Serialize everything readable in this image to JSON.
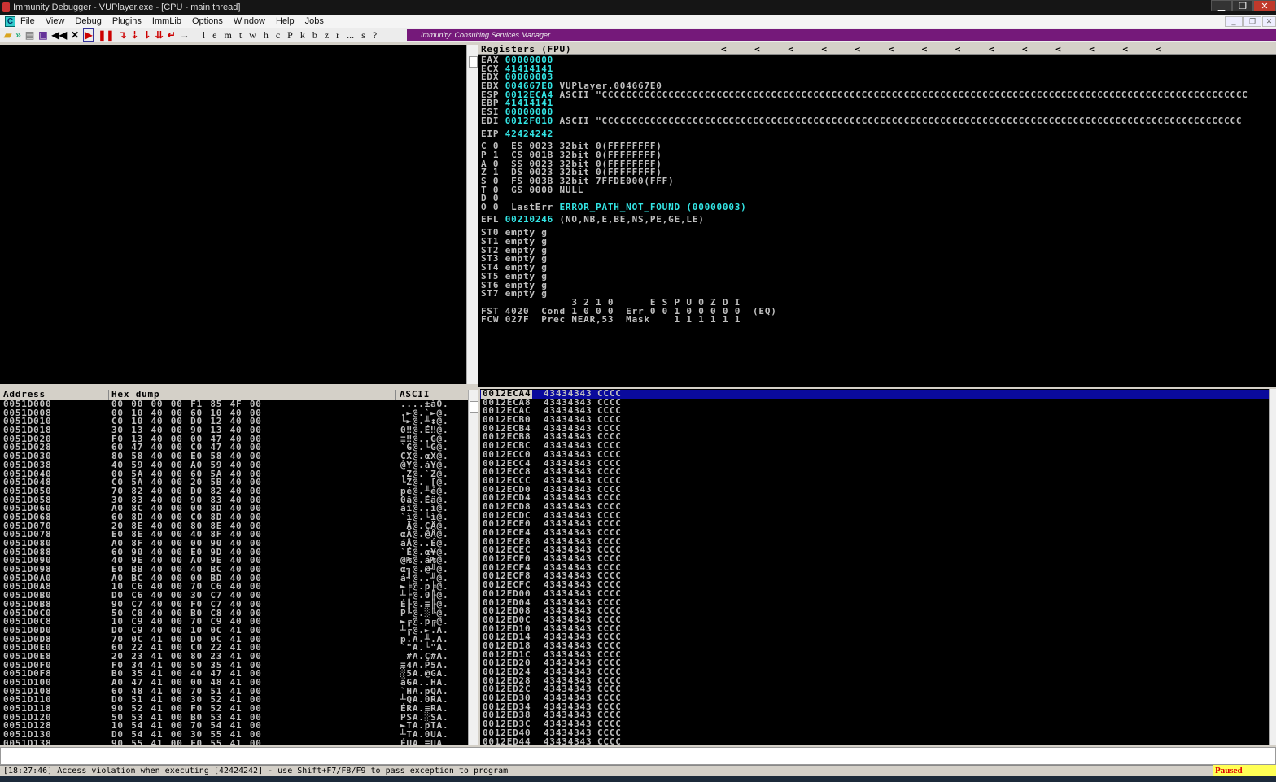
{
  "window": {
    "title": "Immunity Debugger - VUPlayer.exe - [CPU - main thread]"
  },
  "menu": [
    "File",
    "View",
    "Debug",
    "Plugins",
    "ImmLib",
    "Options",
    "Window",
    "Help",
    "Jobs"
  ],
  "menu_icon": "C",
  "toolbar": {
    "letters": [
      "l",
      "e",
      "m",
      "t",
      "w",
      "h",
      "c",
      "P",
      "k",
      "b",
      "z",
      "r",
      "...",
      "s",
      "?"
    ],
    "banner": "Immunity: Consulting Services Manager"
  },
  "registers": {
    "header": "Registers (FPU)",
    "arrows": "<    <    <    <    <    <    <    <    <    <    <    <    <    <",
    "gp": [
      {
        "name": "EAX",
        "value": "00000000",
        "comment": ""
      },
      {
        "name": "ECX",
        "value": "41414141",
        "comment": ""
      },
      {
        "name": "EDX",
        "value": "00000003",
        "comment": ""
      },
      {
        "name": "EBX",
        "value": "004667E0",
        "comment": "VUPlayer.004667E0"
      },
      {
        "name": "ESP",
        "value": "0012ECA4",
        "comment": "ASCII \"CCCCCCCCCCCCCCCCCCCCCCCCCCCCCCCCCCCCCCCCCCCCCCCCCCCCCCCCCCCCCCCCCCCCCCCCCCCCCCCCCCCCCCCCCCCCCCCCCCCCCCCCCCC"
      },
      {
        "name": "EBP",
        "value": "41414141",
        "comment": ""
      },
      {
        "name": "ESI",
        "value": "00000000",
        "comment": ""
      },
      {
        "name": "EDI",
        "value": "0012F010",
        "comment": "ASCII \"CCCCCCCCCCCCCCCCCCCCCCCCCCCCCCCCCCCCCCCCCCCCCCCCCCCCCCCCCCCCCCCCCCCCCCCCCCCCCCCCCCCCCCCCCCCCCCCCCCCCCCCCCC"
      }
    ],
    "eip": {
      "name": "EIP",
      "value": "42424242"
    },
    "segs": [
      "C 0  ES 0023 32bit 0(FFFFFFFF)",
      "P 1  CS 001B 32bit 0(FFFFFFFF)",
      "A 0  SS 0023 32bit 0(FFFFFFFF)",
      "Z 1  DS 0023 32bit 0(FFFFFFFF)",
      "S 0  FS 003B 32bit 7FFDE000(FFF)",
      "T 0  GS 0000 NULL",
      "D 0"
    ],
    "lasterr": {
      "prefix": "O 0  LastErr ",
      "value": "ERROR_PATH_NOT_FOUND (00000003)"
    },
    "efl": {
      "name": "EFL",
      "value": "00210246",
      "flags": "(NO,NB,E,BE,NS,PE,GE,LE)"
    },
    "fpu": [
      "ST0 empty g",
      "ST1 empty g",
      "ST2 empty g",
      "ST3 empty g",
      "ST4 empty g",
      "ST5 empty g",
      "ST6 empty g",
      "ST7 empty g"
    ],
    "fst_hdr": "               3 2 1 0      E S P U O Z D I",
    "fst": "FST 4020  Cond 1 0 0 0  Err 0 0 1 0 0 0 0 0  (EQ)",
    "fcw": "FCW 027F  Prec NEAR,53  Mask    1 1 1 1 1 1"
  },
  "dump": {
    "headers": {
      "address": "Address",
      "hex": "Hex dump",
      "ascii": "ASCII"
    },
    "rows": [
      [
        "0051D000",
        "00 00 00 00 F1 85 4F 00",
        "....±àO."
      ],
      [
        "0051D008",
        "00 10 40 00 60 10 40 00",
        ".►@.`►@."
      ],
      [
        "0051D010",
        "C0 10 40 00 D0 12 40 00",
        "└►@.╨↕@."
      ],
      [
        "0051D018",
        "30 13 40 00 90 13 40 00",
        "0‼@.É‼@."
      ],
      [
        "0051D020",
        "F0 13 40 00 00 47 40 00",
        "≡‼@..G@."
      ],
      [
        "0051D028",
        "60 47 40 00 C0 47 40 00",
        "`G@.└G@."
      ],
      [
        "0051D030",
        "80 58 40 00 E0 58 40 00",
        "ÇX@.αX@."
      ],
      [
        "0051D038",
        "40 59 40 00 A0 59 40 00",
        "@Y@.áY@."
      ],
      [
        "0051D040",
        "00 5A 40 00 60 5A 40 00",
        ".Z@.`Z@."
      ],
      [
        "0051D048",
        "C0 5A 40 00 20 5B 40 00",
        "└Z@. [@."
      ],
      [
        "0051D050",
        "70 82 40 00 D0 82 40 00",
        "pé@.╨é@."
      ],
      [
        "0051D058",
        "30 83 40 00 90 83 40 00",
        "0â@.Éâ@."
      ],
      [
        "0051D060",
        "A0 8C 40 00 00 8D 40 00",
        "áî@..ì@."
      ],
      [
        "0051D068",
        "60 8D 40 00 C0 8D 40 00",
        "`ì@.└ì@."
      ],
      [
        "0051D070",
        "20 8E 40 00 80 8E 40 00",
        " Ä@.ÇÄ@."
      ],
      [
        "0051D078",
        "E0 8E 40 00 40 8F 40 00",
        "αÄ@.@Å@."
      ],
      [
        "0051D080",
        "A0 8F 40 00 00 90 40 00",
        "áÅ@..É@."
      ],
      [
        "0051D088",
        "60 90 40 00 E0 9D 40 00",
        "`É@.α¥@."
      ],
      [
        "0051D090",
        "40 9E 40 00 A0 9E 40 00",
        "@₧@.á₧@."
      ],
      [
        "0051D098",
        "E0 BB 40 00 40 BC 40 00",
        "α╗@.@╝@."
      ],
      [
        "0051D0A0",
        "A0 BC 40 00 00 BD 40 00",
        "á╝@..╜@."
      ],
      [
        "0051D0A8",
        "10 C6 40 00 70 C6 40 00",
        "►╞@.p╞@."
      ],
      [
        "0051D0B0",
        "D0 C6 40 00 30 C7 40 00",
        "╨╞@.0╟@."
      ],
      [
        "0051D0B8",
        "90 C7 40 00 F0 C7 40 00",
        "É╟@.≡╟@."
      ],
      [
        "0051D0C0",
        "50 C8 40 00 B0 C8 40 00",
        "P╚@.░╚@."
      ],
      [
        "0051D0C8",
        "10 C9 40 00 70 C9 40 00",
        "►╔@.p╔@."
      ],
      [
        "0051D0D0",
        "D0 C9 40 00 10 0C 41 00",
        "╨╔@.►.A."
      ],
      [
        "0051D0D8",
        "70 0C 41 00 D0 0C 41 00",
        "p.A.╨.A."
      ],
      [
        "0051D0E0",
        "60 22 41 00 C0 22 41 00",
        "`\"A.└\"A."
      ],
      [
        "0051D0E8",
        "20 23 41 00 80 23 41 00",
        " #A.Ç#A."
      ],
      [
        "0051D0F0",
        "F0 34 41 00 50 35 41 00",
        "≡4A.P5A."
      ],
      [
        "0051D0F8",
        "B0 35 41 00 40 47 41 00",
        "░5A.@GA."
      ],
      [
        "0051D100",
        "A0 47 41 00 00 48 41 00",
        "áGA..HA."
      ],
      [
        "0051D108",
        "60 48 41 00 70 51 41 00",
        "`HA.pQA."
      ],
      [
        "0051D110",
        "D0 51 41 00 30 52 41 00",
        "╨QA.0RA."
      ],
      [
        "0051D118",
        "90 52 41 00 F0 52 41 00",
        "ÉRA.≡RA."
      ],
      [
        "0051D120",
        "50 53 41 00 B0 53 41 00",
        "PSA.░SA."
      ],
      [
        "0051D128",
        "10 54 41 00 70 54 41 00",
        "►TA.pTA."
      ],
      [
        "0051D130",
        "D0 54 41 00 30 55 41 00",
        "╨TA.0UA."
      ],
      [
        "0051D138",
        "90 55 41 00 F0 55 41 00",
        "ÉUA.≡UA."
      ]
    ]
  },
  "stack": {
    "value": "43434343",
    "ascii": "CCCC",
    "addresses": [
      "0012ECA4",
      "0012ECA8",
      "0012ECAC",
      "0012ECB0",
      "0012ECB4",
      "0012ECB8",
      "0012ECBC",
      "0012ECC0",
      "0012ECC4",
      "0012ECC8",
      "0012ECCC",
      "0012ECD0",
      "0012ECD4",
      "0012ECD8",
      "0012ECDC",
      "0012ECE0",
      "0012ECE4",
      "0012ECE8",
      "0012ECEC",
      "0012ECF0",
      "0012ECF4",
      "0012ECF8",
      "0012ECFC",
      "0012ED00",
      "0012ED04",
      "0012ED08",
      "0012ED0C",
      "0012ED10",
      "0012ED14",
      "0012ED18",
      "0012ED1C",
      "0012ED20",
      "0012ED24",
      "0012ED28",
      "0012ED2C",
      "0012ED30",
      "0012ED34",
      "0012ED38",
      "0012ED3C",
      "0012ED40",
      "0012ED44"
    ]
  },
  "status": {
    "message": "[18:27:46] Access violation when executing [42424242] - use Shift+F7/F8/F9 to pass exception to program",
    "state": "Paused"
  },
  "colors": {
    "banner": "#75197a",
    "highlight": "#0a0a9c",
    "cyan": "#33e5e5",
    "paused_bg": "#ffff55"
  }
}
